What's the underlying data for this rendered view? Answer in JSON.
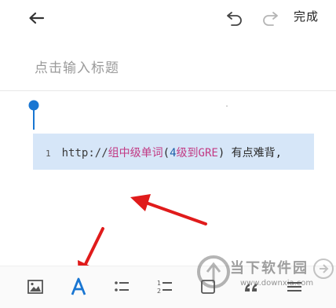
{
  "toolbar_top": {
    "done_label": "完成"
  },
  "editor": {
    "title_placeholder": "点击输入标题",
    "code_block": {
      "line_number": "1",
      "segments": {
        "url": "http://",
        "pink1": "组中级单词",
        "paren_open": "(",
        "num": "4",
        "mid": "级到",
        "gre": "GRE",
        "paren_close": ")",
        "tail": " 有点难背,"
      }
    }
  },
  "watermark": {
    "brand": "当下软件园",
    "url": "www.downxia.com"
  },
  "colors": {
    "accent": "#1976d2",
    "code_bg": "#d6e6f8",
    "arrow": "#e01b1b",
    "pink_text": "#c23a84"
  },
  "icons": {
    "back": "arrow-left",
    "undo": "undo",
    "redo": "redo",
    "image": "image",
    "text_format": "letter-a",
    "bullet_list": "bullet-list",
    "numbered_list": "numbered-list",
    "checkbox": "checkbox",
    "quote": "quote",
    "more": "menu"
  }
}
